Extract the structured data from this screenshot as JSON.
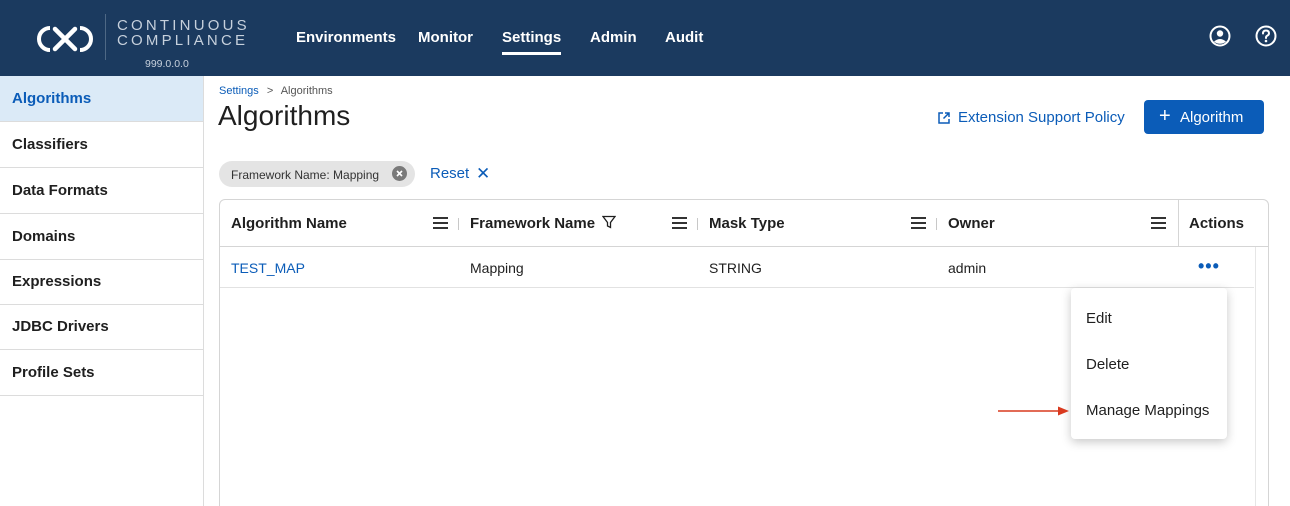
{
  "header": {
    "brand_line1": "CONTINUOUS",
    "brand_line2": "COMPLIANCE",
    "version": "999.0.0.0",
    "nav": [
      "Environments",
      "Monitor",
      "Settings",
      "Admin",
      "Audit"
    ],
    "active_nav": "Settings",
    "icons": [
      "account-icon",
      "help-icon"
    ],
    "bg_color": "#1b3a5f"
  },
  "sidebar": {
    "items": [
      "Algorithms",
      "Classifiers",
      "Data Formats",
      "Domains",
      "Expressions",
      "JDBC Drivers",
      "Profile Sets"
    ],
    "active": "Algorithms"
  },
  "breadcrumb": {
    "parent": "Settings",
    "separator": ">",
    "current": "Algorithms"
  },
  "page": {
    "title": "Algorithms",
    "extension_link": "Extension Support Policy",
    "add_button": "Algorithm",
    "accent_color": "#0b5cb8"
  },
  "filters": {
    "chip_label": "Framework Name: Mapping",
    "reset_label": "Reset"
  },
  "table": {
    "columns": [
      "Algorithm Name",
      "Framework Name",
      "Mask Type",
      "Owner",
      "Actions"
    ],
    "rows": [
      {
        "name": "TEST_MAP",
        "framework": "Mapping",
        "mask_type": "STRING",
        "owner": "admin"
      }
    ],
    "row_actions_label": "•••"
  },
  "row_menu": {
    "items": [
      "Edit",
      "Delete",
      "Manage Mappings"
    ]
  }
}
